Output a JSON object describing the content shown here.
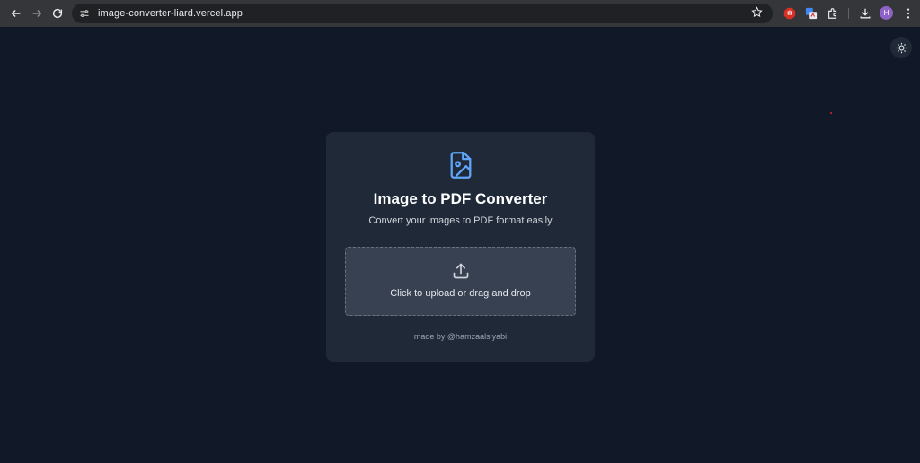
{
  "browser": {
    "url": "image-converter-liard.vercel.app",
    "avatar_letter": "H"
  },
  "card": {
    "title": "Image to PDF Converter",
    "subtitle": "Convert your images to PDF format easily",
    "dropzone_text": "Click to upload or drag and drop",
    "footer": "made by @hamzaalsiyabi"
  },
  "colors": {
    "page_bg": "#111827",
    "card_bg": "#1f2937",
    "dropzone_bg": "#374151",
    "accent": "#60a5fa"
  }
}
